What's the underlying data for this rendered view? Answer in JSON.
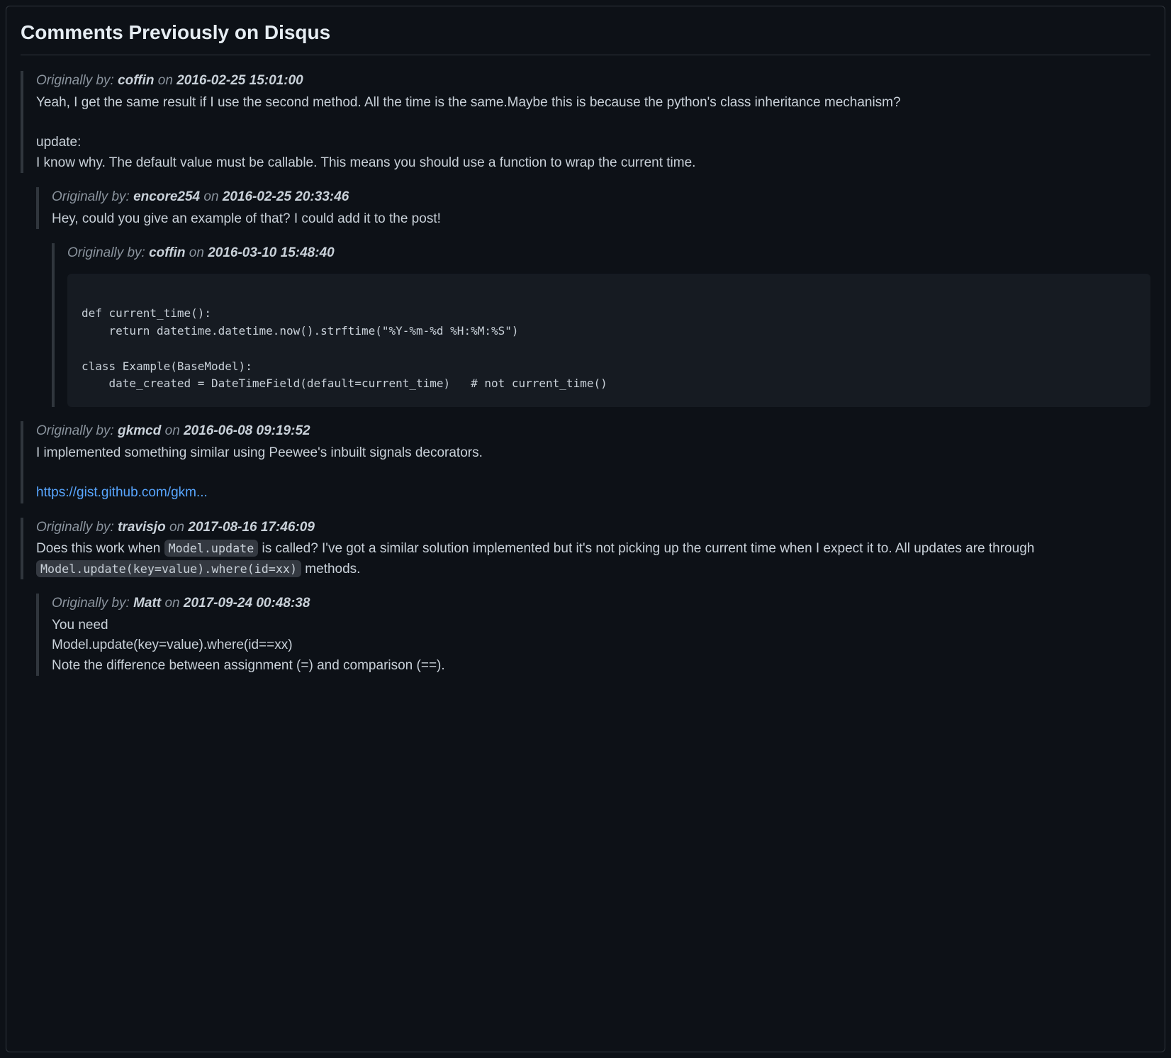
{
  "title": "Comments Previously on Disqus",
  "labels": {
    "originally_by": "Originally by:",
    "on": "on"
  },
  "comments": [
    {
      "level": 0,
      "author": "coffin",
      "date": "2016-02-25 15:01:00",
      "paragraphs": [
        "Yeah, I get the same result if I use the second method. All the time is the same.Maybe this is because the python's class inheritance mechanism?",
        "update:\nI know why. The default value must be callable. This means you should use a function to wrap the current time."
      ]
    },
    {
      "level": 1,
      "author": "encore254",
      "date": "2016-02-25 20:33:46",
      "paragraphs": [
        "Hey, could you give an example of that? I could add it to the post!"
      ]
    },
    {
      "level": 2,
      "author": "coffin",
      "date": "2016-03-10 15:48:40",
      "code": "\ndef current_time():\n    return datetime.datetime.now().strftime(\"%Y-%m-%d %H:%M:%S\")\n\nclass Example(BaseModel):\n    date_created = DateTimeField(default=current_time)   # not current_time()\n"
    },
    {
      "level": 0,
      "author": "gkmcd",
      "date": "2016-06-08 09:19:52",
      "paragraphs": [
        "I implemented something similar using Peewee's inbuilt signals decorators."
      ],
      "link": "https://gist.github.com/gkm..."
    },
    {
      "level": 0,
      "author": "travisjo",
      "date": "2017-08-16 17:46:09",
      "rich": [
        {
          "t": "text",
          "v": "Does this work when "
        },
        {
          "t": "code",
          "v": "Model.update"
        },
        {
          "t": "text",
          "v": " is called? I've got a similar solution implemented but it's not picking up the current time when I expect it to. All updates are through "
        },
        {
          "t": "code",
          "v": "Model.update(key=value).where(id=xx)"
        },
        {
          "t": "text",
          "v": " methods."
        }
      ]
    },
    {
      "level": 1,
      "author": "Matt",
      "date": "2017-09-24 00:48:38",
      "paragraphs": [
        "You need\nModel.update(key=value).where(id==xx)\nNote the difference between assignment (=) and comparison (==)."
      ]
    }
  ]
}
